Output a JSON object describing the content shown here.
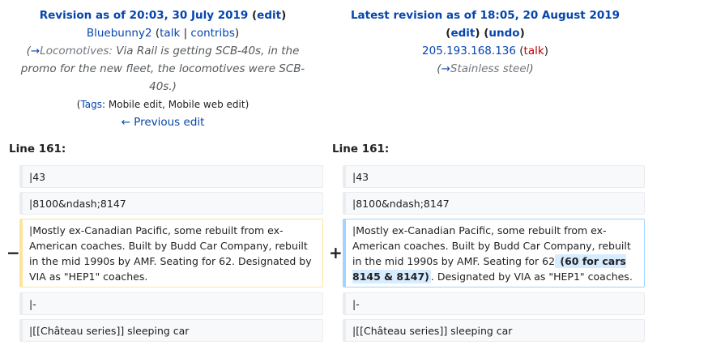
{
  "left": {
    "title_link": "Revision as of 20:03, 30 July 2019",
    "edit": "edit",
    "user": "Bluebunny2",
    "talk": "talk",
    "contribs": "contribs",
    "summary_arrow": "→",
    "summary_section": "Locomotives:",
    "summary_text": "Via Rail is getting SCB-40s, in the promo for the new fleet, the locomotives were SCB-40s.)",
    "tags_label": "Tags",
    "tags_text": ": Mobile edit, Mobile web edit)",
    "prev_edit": "← Previous edit"
  },
  "right": {
    "title_link": "Latest revision as of 18:05, 20 August 2019",
    "edit": "edit",
    "undo": "undo",
    "user": "205.193.168.136",
    "talk": "talk",
    "summary_arrow": "→",
    "summary_text": "Stainless steel"
  },
  "diff": {
    "line_label": "Line 161:",
    "rows": [
      {
        "left": "|43",
        "right": "|43"
      },
      {
        "left": "|8100&ndash;8147",
        "right": "|8100&ndash;8147"
      },
      {
        "left": "|Mostly ex-Canadian Pacific, some rebuilt from ex-American coaches. Built by Budd Car Company, rebuilt in the mid 1990s by AMF. Seating for 62. Designated by VIA as \"HEP1\" coaches.",
        "right_before": "|Mostly ex-Canadian Pacific, some rebuilt from ex-American coaches. Built by Budd Car Company, rebuilt in the mid 1990s by AMF. Seating for 62",
        "right_inserted": " (60 for cars 8145 & 8147)",
        "right_after": ". Designated by VIA as \"HEP1\" coaches."
      },
      {
        "left": "|-",
        "right": "|-"
      },
      {
        "left": "|[[Château series]] sleeping car",
        "right": "|[[Château series]] sleeping car"
      }
    ],
    "minus": "−",
    "plus": "+"
  },
  "colors": {
    "link": "#0645ad",
    "redlink": "#ba0000",
    "deleted_border": "#ffe49c",
    "added_border": "#a3d3ff",
    "inserted_bg": "#d8ecff"
  }
}
